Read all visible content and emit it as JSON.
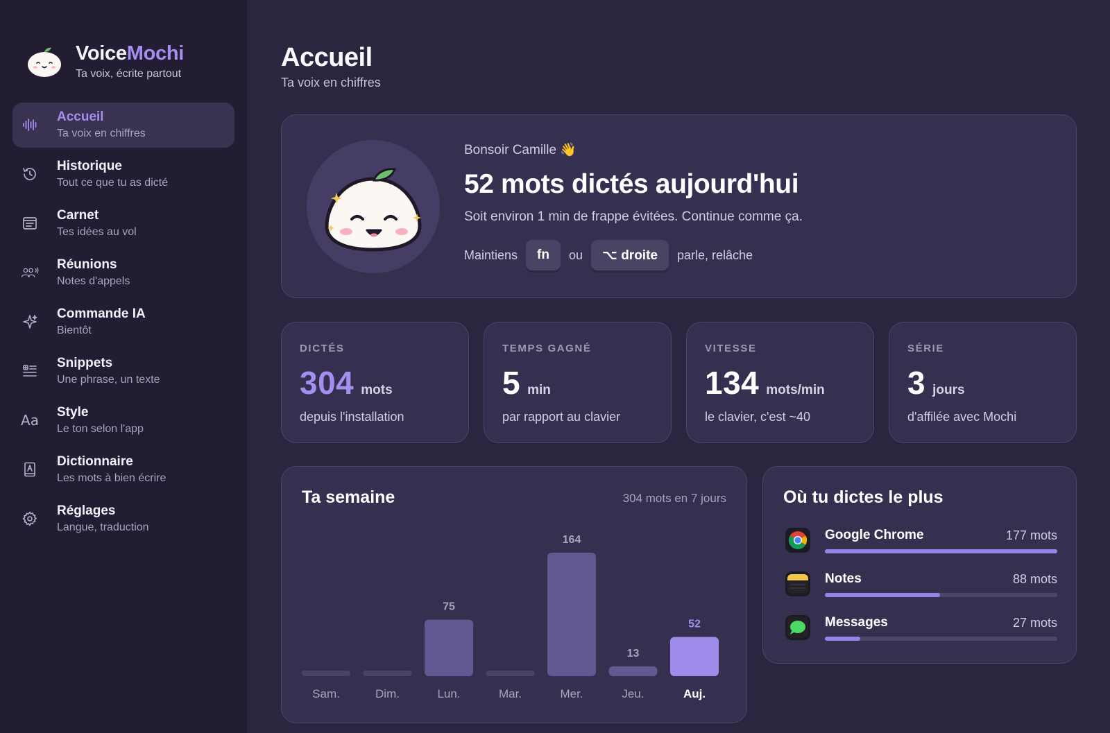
{
  "brand": {
    "name_main": "Voice",
    "name_accent": "Mochi",
    "tagline": "Ta voix, écrite partout"
  },
  "sidebar": {
    "items": [
      {
        "label": "Accueil",
        "sub": "Ta voix en chiffres",
        "icon": "waveform-icon",
        "active": true
      },
      {
        "label": "Historique",
        "sub": "Tout ce que tu as dicté",
        "icon": "history-icon"
      },
      {
        "label": "Carnet",
        "sub": "Tes idées au vol",
        "icon": "notebook-icon"
      },
      {
        "label": "Réunions",
        "sub": "Notes d'appels",
        "icon": "people-speaking-icon"
      },
      {
        "label": "Commande IA",
        "sub": "Bientôt",
        "icon": "sparkle-icon"
      },
      {
        "label": "Snippets",
        "sub": "Une phrase, un texte",
        "icon": "snippet-list-icon"
      },
      {
        "label": "Style",
        "sub": "Le ton selon l'app",
        "icon": "font-aa-icon"
      },
      {
        "label": "Dictionnaire",
        "sub": "Les mots à bien écrire",
        "icon": "dictionary-book-icon"
      },
      {
        "label": "Réglages",
        "sub": "Langue, traduction",
        "icon": "gear-icon"
      }
    ]
  },
  "header": {
    "title": "Accueil",
    "subtitle": "Ta voix en chiffres"
  },
  "hero": {
    "greeting": "Bonsoir Camille 👋",
    "title": "52 mots dictés aujourd'hui",
    "description": "Soit environ 1 min de frappe évitées. Continue comme ça.",
    "hold_label": "Maintiens",
    "key1": "fn",
    "or_label": "ou",
    "key2": "⌥ droite",
    "after_label": "parle, relâche"
  },
  "stats": [
    {
      "label": "DICTÉS",
      "value": "304",
      "unit": "mots",
      "sub": "depuis l'installation",
      "accent": true
    },
    {
      "label": "TEMPS GAGNÉ",
      "value": "5",
      "unit": "min",
      "sub": "par rapport au clavier"
    },
    {
      "label": "VITESSE",
      "value": "134",
      "unit": "mots/min",
      "sub": "le clavier, c'est ~40"
    },
    {
      "label": "SÉRIE",
      "value": "3",
      "unit": "jours",
      "sub": "d'affilée avec Mochi"
    }
  ],
  "week": {
    "title": "Ta semaine",
    "total": "304 mots en 7 jours",
    "days": [
      {
        "label": "Sam.",
        "value": 0
      },
      {
        "label": "Dim.",
        "value": 0
      },
      {
        "label": "Lun.",
        "value": 75
      },
      {
        "label": "Mar.",
        "value": 0
      },
      {
        "label": "Mer.",
        "value": 164
      },
      {
        "label": "Jeu.",
        "value": 13
      },
      {
        "label": "Auj.",
        "value": 52,
        "today": true
      }
    ]
  },
  "apps": {
    "title": "Où tu dictes le plus",
    "items": [
      {
        "name": "Google Chrome",
        "count": "177 mots",
        "share": 1.0,
        "icon": "chrome-icon"
      },
      {
        "name": "Notes",
        "count": "88 mots",
        "share": 0.497,
        "icon": "notes-app-icon"
      },
      {
        "name": "Messages",
        "count": "27 mots",
        "share": 0.153,
        "icon": "messages-app-icon"
      }
    ]
  },
  "colors": {
    "accent": "#a48ef0",
    "bar": "#625892",
    "bar_today": "#9e8bea",
    "bg": "#2b253f",
    "sidebar": "#221d33"
  }
}
